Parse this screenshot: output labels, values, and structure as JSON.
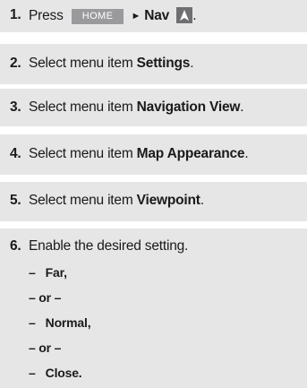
{
  "steps": [
    {
      "num": "1.",
      "pre": "Press",
      "key": "HOME",
      "arrow": "►",
      "target": "Nav",
      "icon": "nav-arrow-icon",
      "post": "."
    },
    {
      "num": "2.",
      "pre": "Select menu item ",
      "bold": "Settings",
      "post": "."
    },
    {
      "num": "3.",
      "pre": "Select menu item ",
      "bold": "Navigation View",
      "post": "."
    },
    {
      "num": "4.",
      "pre": "Select menu item ",
      "bold": "Map Appearance",
      "post": "."
    },
    {
      "num": "5.",
      "pre": "Select menu item ",
      "bold": "Viewpoint",
      "post": "."
    },
    {
      "num": "6.",
      "text": "Enable the desired setting."
    }
  ],
  "options": [
    {
      "dash": "–",
      "label": "Far,"
    },
    {
      "or": "– or –"
    },
    {
      "dash": "–",
      "label": "Normal,"
    },
    {
      "or": "– or –"
    },
    {
      "dash": "–",
      "label": "Close."
    }
  ],
  "colors": {
    "band": "#e6e6e7",
    "key_bg": "#9a9a9d",
    "icon_bg": "#6f6f72"
  }
}
